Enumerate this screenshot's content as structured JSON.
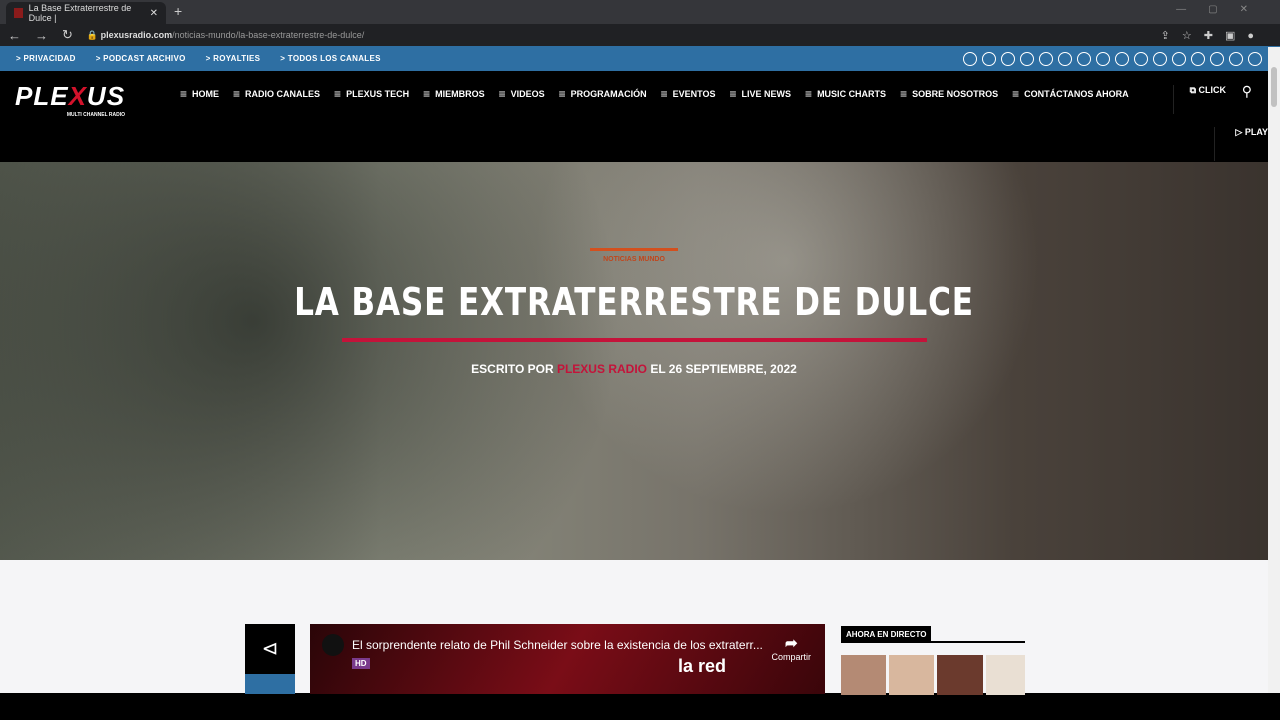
{
  "browser": {
    "tab_title": "La Base Extraterrestre de Dulce |",
    "url_host": "plexusradio.com",
    "url_path": "/noticias-mundo/la-base-extraterrestre-de-dulce/"
  },
  "topbar": {
    "links": [
      "> PRIVACIDAD",
      "> PODCAST ARCHIVO",
      "> ROYALTIES",
      "> TODOS LOS CANALES"
    ]
  },
  "nav": {
    "logo": "PLEXUS",
    "logo_sub": "MULTI CHANNEL RADIO",
    "items": [
      "HOME",
      "RADIO CANALES",
      "PLEXUS TECH",
      "MIEMBROS",
      "VIDEOS",
      "PROGRAMACIÓN",
      "EVENTOS",
      "LIVE NEWS",
      "MUSIC CHARTS",
      "SOBRE NOSOTROS",
      "CONTÁCTANOS AHORA"
    ],
    "click": "CLICK",
    "play": "PLAY"
  },
  "hero": {
    "category": "NOTICIAS MUNDO",
    "title": "LA BASE EXTRATERRESTRE DE DULCE",
    "by": "ESCRITO POR",
    "author": "PLEXUS RADIO",
    "date": "EL 26 SEPTIEMBRE, 2022"
  },
  "video": {
    "title": "El sorprendente relato de Phil Schneider sobre la existencia de los extraterr...",
    "hd": "HD",
    "share": "Compartir",
    "channel": "la red"
  },
  "sidebar": {
    "heading": "AHORA EN DIRECTO"
  }
}
